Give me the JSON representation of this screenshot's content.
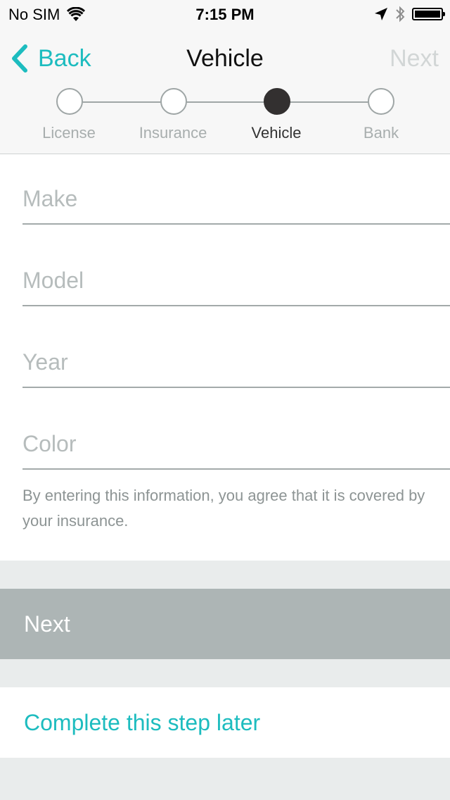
{
  "status_bar": {
    "carrier": "No SIM",
    "time": "7:15 PM"
  },
  "nav": {
    "back_label": "Back",
    "title": "Vehicle",
    "next_label": "Next"
  },
  "steps": [
    {
      "label": "License",
      "state": "incomplete"
    },
    {
      "label": "Insurance",
      "state": "incomplete"
    },
    {
      "label": "Vehicle",
      "state": "current"
    },
    {
      "label": "Bank",
      "state": "incomplete"
    }
  ],
  "form": {
    "make": {
      "placeholder": "Make",
      "value": ""
    },
    "model": {
      "placeholder": "Model",
      "value": ""
    },
    "year": {
      "placeholder": "Year",
      "value": ""
    },
    "color": {
      "placeholder": "Color",
      "value": ""
    },
    "disclaimer": "By entering this information, you agree that it is covered by your insurance."
  },
  "actions": {
    "next_label": "Next",
    "later_label": "Complete this step later"
  },
  "colors": {
    "accent": "#1dbcbf",
    "disabled_button": "#adb5b5",
    "active_step": "#333030"
  }
}
